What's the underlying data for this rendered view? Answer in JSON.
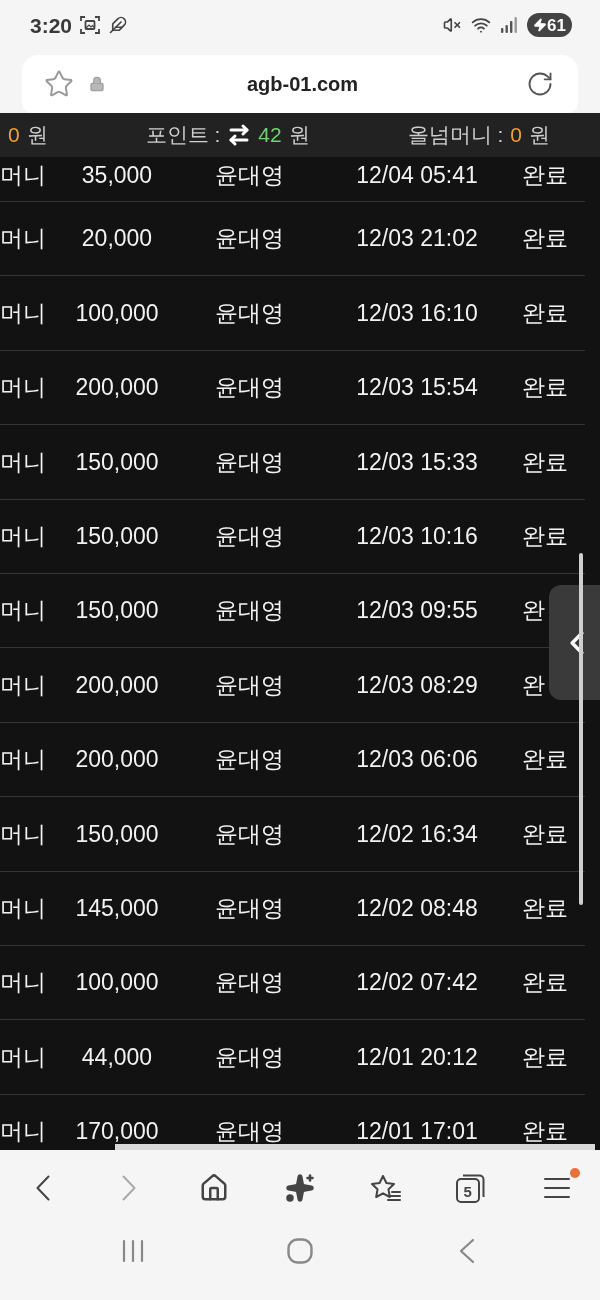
{
  "status_bar": {
    "time": "3:20",
    "battery": "61"
  },
  "address_bar": {
    "url": "agb-01.com"
  },
  "balance_bar": [
    {
      "kind": "money",
      "value": "0",
      "unit": "원",
      "color": "#f0a030"
    },
    {
      "kind": "point",
      "label": "포인트 :",
      "value": "42",
      "unit": "원",
      "color": "#6fd36f"
    },
    {
      "kind": "money",
      "label": "올넘머니 :",
      "value": "0",
      "unit": "원",
      "color": "#f0a030"
    }
  ],
  "table": {
    "rows": [
      {
        "column_1": "머니",
        "column_2": "35,000",
        "column_3": "윤대영",
        "column_4": "12/04 05:41",
        "column_5": "완료"
      },
      {
        "column_1": "머니",
        "column_2": "20,000",
        "column_3": "윤대영",
        "column_4": "12/03 21:02",
        "column_5": "완료"
      },
      {
        "column_1": "머니",
        "column_2": "100,000",
        "column_3": "윤대영",
        "column_4": "12/03 16:10",
        "column_5": "완료"
      },
      {
        "column_1": "머니",
        "column_2": "200,000",
        "column_3": "윤대영",
        "column_4": "12/03 15:54",
        "column_5": "완료"
      },
      {
        "column_1": "머니",
        "column_2": "150,000",
        "column_3": "윤대영",
        "column_4": "12/03 15:33",
        "column_5": "완료"
      },
      {
        "column_1": "머니",
        "column_2": "150,000",
        "column_3": "윤대영",
        "column_4": "12/03 10:16",
        "column_5": "완료"
      },
      {
        "column_1": "머니",
        "column_2": "150,000",
        "column_3": "윤대영",
        "column_4": "12/03 09:55",
        "column_5": "완"
      },
      {
        "column_1": "머니",
        "column_2": "200,000",
        "column_3": "윤대영",
        "column_4": "12/03 08:29",
        "column_5": "완"
      },
      {
        "column_1": "머니",
        "column_2": "200,000",
        "column_3": "윤대영",
        "column_4": "12/03 06:06",
        "column_5": "완료"
      },
      {
        "column_1": "머니",
        "column_2": "150,000",
        "column_3": "윤대영",
        "column_4": "12/02 16:34",
        "column_5": "완료"
      },
      {
        "column_1": "머니",
        "column_2": "145,000",
        "column_3": "윤대영",
        "column_4": "12/02 08:48",
        "column_5": "완료"
      },
      {
        "column_1": "머니",
        "column_2": "100,000",
        "column_3": "윤대영",
        "column_4": "12/02 07:42",
        "column_5": "완료"
      },
      {
        "column_1": "머니",
        "column_2": "44,000",
        "column_3": "윤대영",
        "column_4": "12/01 20:12",
        "column_5": "완료"
      },
      {
        "column_1": "머니",
        "column_2": "170,000",
        "column_3": "윤대영",
        "column_4": "12/01 17:01",
        "column_5": "완료"
      }
    ]
  },
  "browser_toolbar": {
    "buttons": [
      {
        "kind": "back",
        "disabled": false,
        "badge": false
      },
      {
        "kind": "forward",
        "disabled": true,
        "badge": false
      },
      {
        "kind": "home",
        "disabled": false,
        "badge": false
      },
      {
        "kind": "assistant",
        "disabled": false,
        "badge": false
      },
      {
        "kind": "bookmarks",
        "disabled": false,
        "badge": false
      },
      {
        "kind": "tabs",
        "label": "5",
        "disabled": false,
        "badge": false
      },
      {
        "kind": "menu",
        "disabled": false,
        "badge": true
      }
    ]
  }
}
